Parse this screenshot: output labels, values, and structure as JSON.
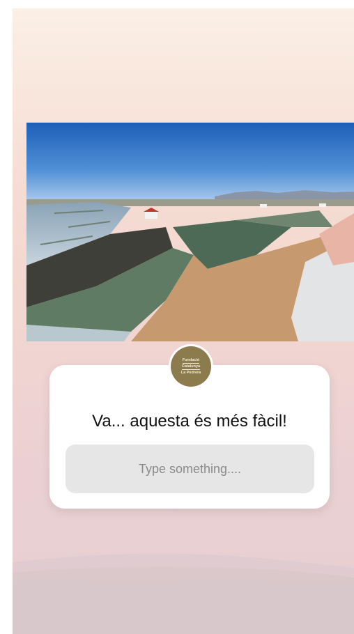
{
  "story": {
    "badge": {
      "lines": [
        "Fundació",
        "Catalunya",
        "La Pedrera"
      ]
    },
    "question": {
      "text": "Va... aquesta és més fàcil!",
      "placeholder": "Type something...."
    }
  },
  "colors": {
    "badge_gold": "#8c7b4c",
    "card_background": "#ffffff",
    "input_background": "#e6e6e6"
  }
}
